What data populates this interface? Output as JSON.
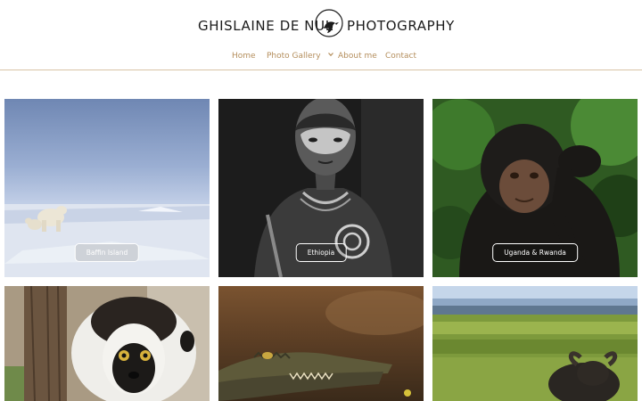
{
  "brand": {
    "name_left": "GHISLAINE DE NUL",
    "name_right": "PHOTOGRAPHY",
    "logo_icon": "bird-in-circle-icon"
  },
  "nav": {
    "items": [
      {
        "label": "Home"
      },
      {
        "label": "Photo Gallery",
        "icon": "chevron-down-icon"
      },
      {
        "label": "About me"
      },
      {
        "label": "Contact"
      }
    ]
  },
  "colors": {
    "nav_text": "#b48e5c",
    "rule": "#d8c3a5",
    "logo_text": "#1b1b1b"
  },
  "gallery": {
    "tiles": [
      {
        "label": "Baffin Island",
        "subject": "polar bears on snow"
      },
      {
        "label": "Ethiopia",
        "subject": "portrait with painted face, black and white"
      },
      {
        "label": "Uganda & Rwanda",
        "subject": "chimpanzee in forest"
      },
      {
        "label": "",
        "subject": "sifaka lemur"
      },
      {
        "label": "",
        "subject": "crocodile head"
      },
      {
        "label": "",
        "subject": "buffalo in savanna"
      }
    ]
  }
}
